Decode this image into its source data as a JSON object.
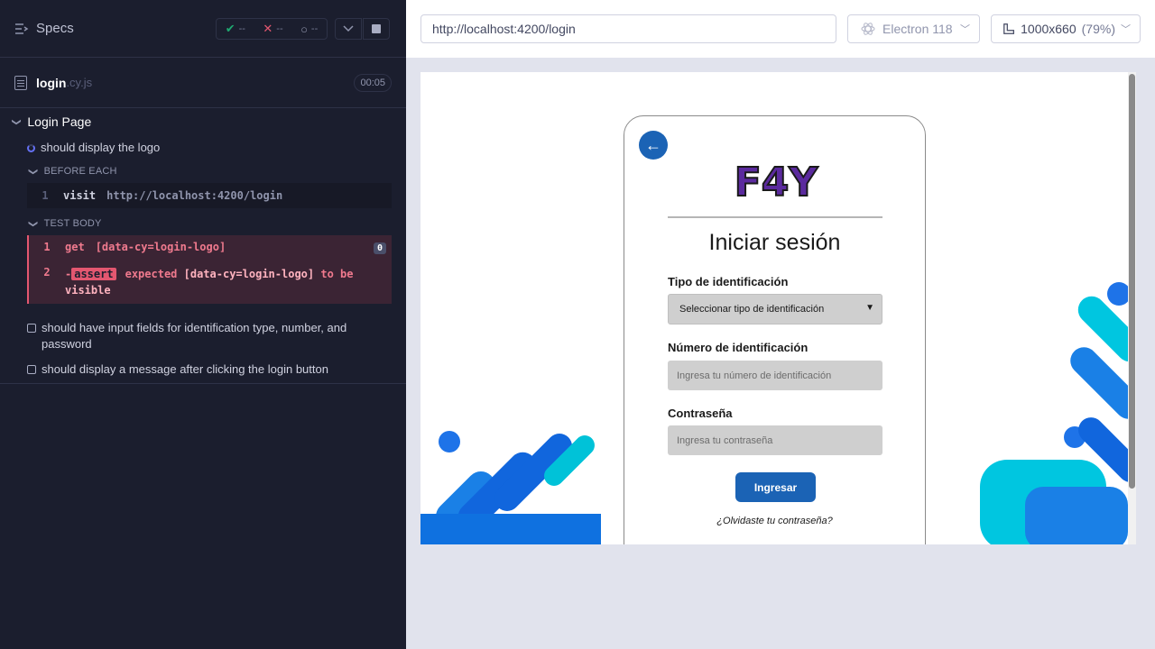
{
  "reporter": {
    "specs_label": "Specs",
    "stats": {
      "passed": "--",
      "failed": "--",
      "pending": "--"
    },
    "spec": {
      "name": "login",
      "ext": ".cy.js",
      "duration": "00:05"
    },
    "suite": {
      "title": "Login Page",
      "tests": [
        {
          "title": "should display the logo",
          "state": "running"
        },
        {
          "title": "should have input fields for identification type, number, and password",
          "state": "pending"
        },
        {
          "title": "should display a message after clicking the login button",
          "state": "pending"
        }
      ],
      "before_each": {
        "label": "BEFORE EACH",
        "commands": [
          {
            "num": "1",
            "name": "visit",
            "message": "http://localhost:4200/login"
          }
        ]
      },
      "test_body": {
        "label": "TEST BODY",
        "commands": [
          {
            "num": "1",
            "name": "get",
            "message": "[data-cy=login-logo]",
            "badge": "0"
          },
          {
            "num": "2",
            "prefix": "-",
            "name": "assert",
            "message_part1": "expected",
            "message_part2": "[data-cy=login-logo]",
            "message_part3": "to be",
            "message_part4": "visible"
          }
        ]
      }
    }
  },
  "aut": {
    "url": "http://localhost:4200/login",
    "browser": "Electron 118",
    "viewport": "1000x660",
    "zoom": "(79%)"
  },
  "app": {
    "logo_text": "F4Y",
    "title": "Iniciar sesión",
    "id_type_label": "Tipo de identificación",
    "id_type_value": "Seleccionar tipo de identificación",
    "id_number_label": "Número de identificación",
    "id_number_placeholder": "Ingresa tu número de identificación",
    "password_label": "Contraseña",
    "password_placeholder": "Ingresa tu contraseña",
    "submit_label": "Ingresar",
    "forgot_label": "¿Olvidaste tu contraseña?"
  },
  "colors": {
    "reporter_bg": "#1b1e2e",
    "fail_red": "#e45770",
    "pass_green": "#1fa971",
    "app_primary": "#1b63b5",
    "aut_bg": "#e1e3ed"
  }
}
